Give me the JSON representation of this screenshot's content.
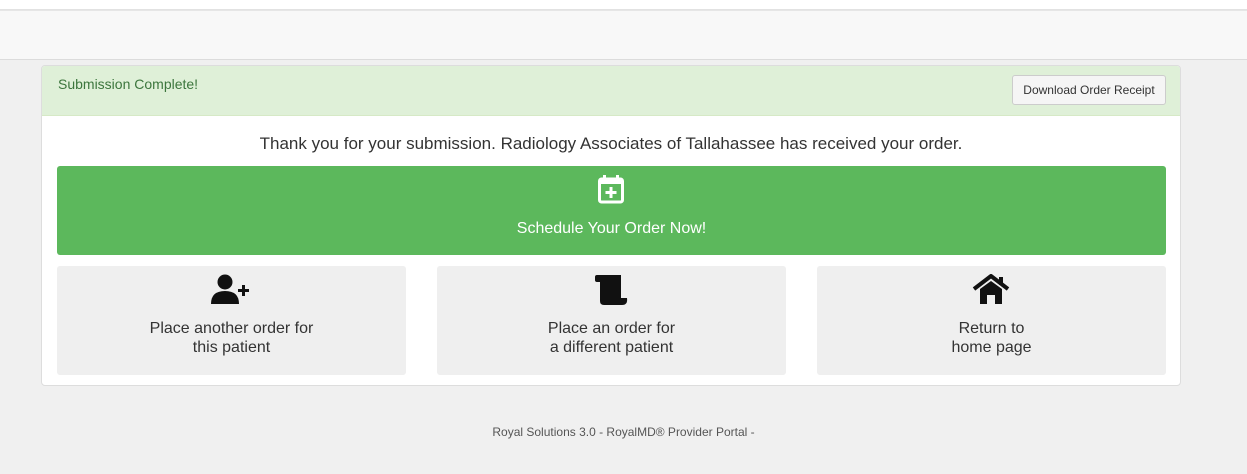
{
  "panel": {
    "heading_title": "Submission Complete!",
    "receipt_button_label": "Download Order Receipt",
    "thanks_message": "Thank you for your submission. Radiology Associates of Tallahassee has received your order."
  },
  "schedule": {
    "icon": "calendar-plus-icon",
    "label": "Schedule Your Order Now!"
  },
  "tiles": [
    {
      "icon": "user-plus-icon",
      "line1": "Place another order for",
      "line2": "this patient"
    },
    {
      "icon": "scroll-icon",
      "line1": "Place an order for",
      "line2": "a different patient"
    },
    {
      "icon": "home-icon",
      "line1": "Return to",
      "line2": "home page"
    }
  ],
  "footer": {
    "text": "Royal Solutions 3.0 - RoyalMD® Provider Portal -"
  },
  "colors": {
    "success_green": "#5cb85c",
    "alert_bg": "#dff0d8",
    "alert_text": "#3c763d",
    "tile_bg": "#efefef",
    "page_bg": "#f0f0f0"
  }
}
